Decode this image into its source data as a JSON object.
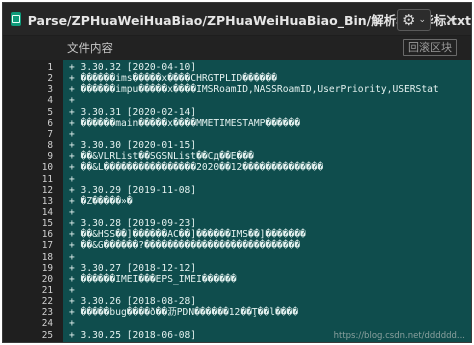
{
  "window": {
    "title": "Parse/ZPHuaWeiHuaBiao/ZPHuaWeiHuaBiao_Bin/解析华为华标.txt",
    "gear_icon": "⚙",
    "chevron_icon": "⌄",
    "close_icon": "✕"
  },
  "toolbar": {
    "content_label": "文件内容",
    "scroll_lock_label": "回滚区块"
  },
  "editor": {
    "lines": [
      {
        "no": "1",
        "text": "+ 3.30.32 [2020-04-10]"
      },
      {
        "no": "2",
        "text": "+ ������ims�����x����CHRGTPLID������"
      },
      {
        "no": "3",
        "text": "+ ������impu�����x����IMSRoamID,NASSRoamID,UserPriority,USERStat"
      },
      {
        "no": "4",
        "text": "+"
      },
      {
        "no": "5",
        "text": "+ 3.30.31 [2020-02-14]"
      },
      {
        "no": "6",
        "text": "+ ������main�����x����MMETIMESTAMP������"
      },
      {
        "no": "7",
        "text": "+"
      },
      {
        "no": "8",
        "text": "+ 3.30.30 [2020-01-15]"
      },
      {
        "no": "9",
        "text": "+ ��&VLRList��SGSNList��Сд��E���"
      },
      {
        "no": "10",
        "text": "+ ��&L����������������2020��12��������������"
      },
      {
        "no": "11",
        "text": "+"
      },
      {
        "no": "12",
        "text": "+ 3.30.29 [2019-11-08]"
      },
      {
        "no": "13",
        "text": "+ �Z�����»�"
      },
      {
        "no": "14",
        "text": "+"
      },
      {
        "no": "15",
        "text": "+ 3.30.28 [2019-09-23]"
      },
      {
        "no": "16",
        "text": "+ ��&HSS��]������AC��]������IMS��]�������"
      },
      {
        "no": "17",
        "text": "+ ��&G������?���������������������������"
      },
      {
        "no": "18",
        "text": "+"
      },
      {
        "no": "19",
        "text": "+ 3.30.27 [2018-12-12]"
      },
      {
        "no": "20",
        "text": "+ ������IMEI���EPS_IMEI������"
      },
      {
        "no": "21",
        "text": "+"
      },
      {
        "no": "22",
        "text": "+ 3.30.26 [2018-08-28]"
      },
      {
        "no": "23",
        "text": "+ �����bug����ð��沥PDN������12��Ţ��l����"
      },
      {
        "no": "24",
        "text": "+"
      },
      {
        "no": "25",
        "text": "+ 3.30.25 [2018-06-08]"
      }
    ]
  },
  "watermark": "https://blog.csdn.net/dddddd..."
}
